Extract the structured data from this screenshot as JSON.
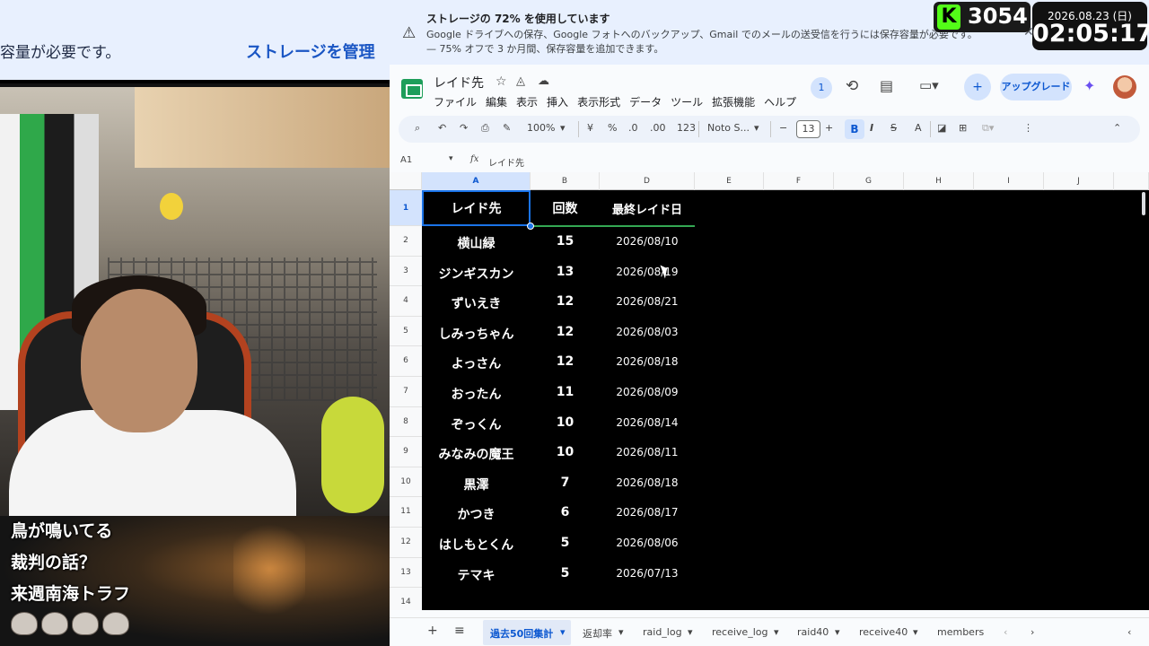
{
  "stream": {
    "banner_left_text": "容量が必要です。",
    "banner_manage_text": "ストレージを管理",
    "captions": [
      "鳥が鳴いてる",
      "裁判の話？",
      "来週南海トラフ"
    ],
    "kick_logo": "K",
    "kick_count": "3054",
    "clock_date": "2026.08.23 (日)",
    "clock_time": "02:05:17"
  },
  "notice": {
    "icon": "warning-icon",
    "title": "ストレージの 72% を使用しています",
    "line1": "Google ドライブへの保存、Google フォトへのバックアップ、Gmail でのメールの送受信を行うには保存容量が必要です。",
    "line2": "— 75% オフで 3 か月間、保存容量を追加できます。"
  },
  "app": {
    "doc_title": "レイド先",
    "menus": [
      "ファイル",
      "編集",
      "表示",
      "挿入",
      "表示形式",
      "データ",
      "ツール",
      "拡張機能",
      "ヘルプ"
    ],
    "viewer_count": "1",
    "upgrade_label": "アップグレード",
    "brand_color": "#1e9e5a",
    "accent_color": "#0b57d0"
  },
  "toolbar": {
    "zoom": "100%",
    "currency": "¥",
    "percent": "%",
    "dec_minus": ".0",
    "dec_plus": ".00",
    "number_fmt": "123",
    "font": "Noto S...",
    "font_size": "13",
    "bold": "B",
    "italic": "I",
    "strike": "S",
    "text_color": "A"
  },
  "formula": {
    "cell_ref": "A1",
    "fx": "fx",
    "value": "レイド先"
  },
  "sheet": {
    "columns": [
      "A",
      "B",
      "D",
      "E",
      "F",
      "G",
      "H",
      "I",
      "J"
    ],
    "headers": [
      "レイド先",
      "回数",
      "最終レイド日"
    ],
    "row_numbers": [
      "1",
      "2",
      "3",
      "4",
      "5",
      "6",
      "7",
      "8",
      "9",
      "10",
      "11",
      "12",
      "13",
      "14"
    ],
    "rows": [
      {
        "name": "横山緑",
        "count": "15",
        "date": "2026/08/10"
      },
      {
        "name": "ジンギスカン",
        "count": "13",
        "date": "2026/08/19"
      },
      {
        "name": "ずいえき",
        "count": "12",
        "date": "2026/08/21"
      },
      {
        "name": "しみっちゃん",
        "count": "12",
        "date": "2026/08/03"
      },
      {
        "name": "よっさん",
        "count": "12",
        "date": "2026/08/18"
      },
      {
        "name": "おったん",
        "count": "11",
        "date": "2026/08/09"
      },
      {
        "name": "ぞっくん",
        "count": "10",
        "date": "2026/08/14"
      },
      {
        "name": "みなみの魔王",
        "count": "10",
        "date": "2026/08/11"
      },
      {
        "name": "黒澤",
        "count": "7",
        "date": "2026/08/18"
      },
      {
        "name": "かつき",
        "count": "6",
        "date": "2026/08/17"
      },
      {
        "name": "はしもとくん",
        "count": "5",
        "date": "2026/08/06"
      },
      {
        "name": "テマキ",
        "count": "5",
        "date": "2026/07/13"
      }
    ]
  },
  "tabs": {
    "items": [
      "過去50回集計",
      "返却率",
      "raid_log",
      "receive_log",
      "raid40",
      "receive40",
      "members"
    ],
    "active": "過去50回集計"
  }
}
